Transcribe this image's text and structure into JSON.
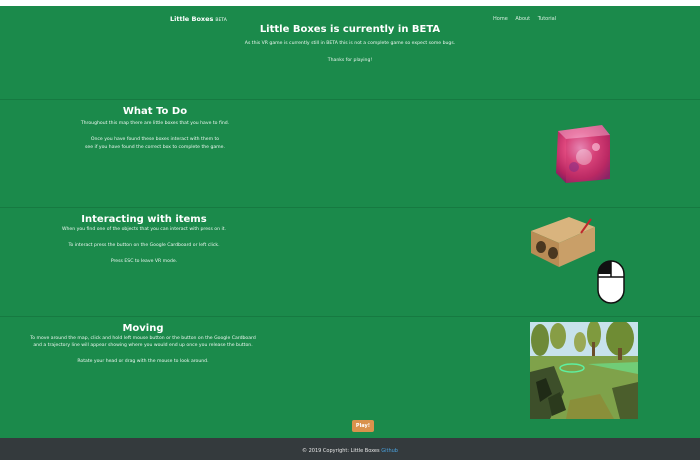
{
  "navbar": {
    "brand": "Little Boxes",
    "brand_sub": "BETA",
    "links": [
      "Home",
      "About",
      "Tutorial"
    ]
  },
  "hero": {
    "title": "Little Boxes is currently in BETA",
    "line1": "As this VR game is currently still in BETA this is not a complete game so expect some bugs.",
    "line2": "Thanks for playing!"
  },
  "what_to_do": {
    "heading": "What To Do",
    "line1": "Throughout this map there are little boxes that you have to find.",
    "line2": "Once you have found these boxes interact with them to",
    "line3": "see if you have found the correct box to complete the game."
  },
  "interacting": {
    "heading": "Interacting with items",
    "line1": "When you find one of the objects that you can interact with press on it.",
    "line2": "To interact press the button on the Google Cardboard or left click.",
    "line3": "Press ESC to leave VR mode."
  },
  "moving": {
    "heading": "Moving",
    "line1": "To move around the map, click and hold left mouse button or the button on the Google Cardboard",
    "line2": "and a trajectory line will appear showing where you would end up once you release the button.",
    "line3": "Rotate your head or drag with the mouse to look around."
  },
  "play_button": "Play!",
  "footer": {
    "text": "© 2019 Copyright: Little Boxes",
    "link": "Github"
  },
  "colors": {
    "page_green": "#1b8a4b",
    "footer_bg": "#343a3d",
    "play_button": "#d9924c",
    "footer_link": "#4aa3e0"
  }
}
